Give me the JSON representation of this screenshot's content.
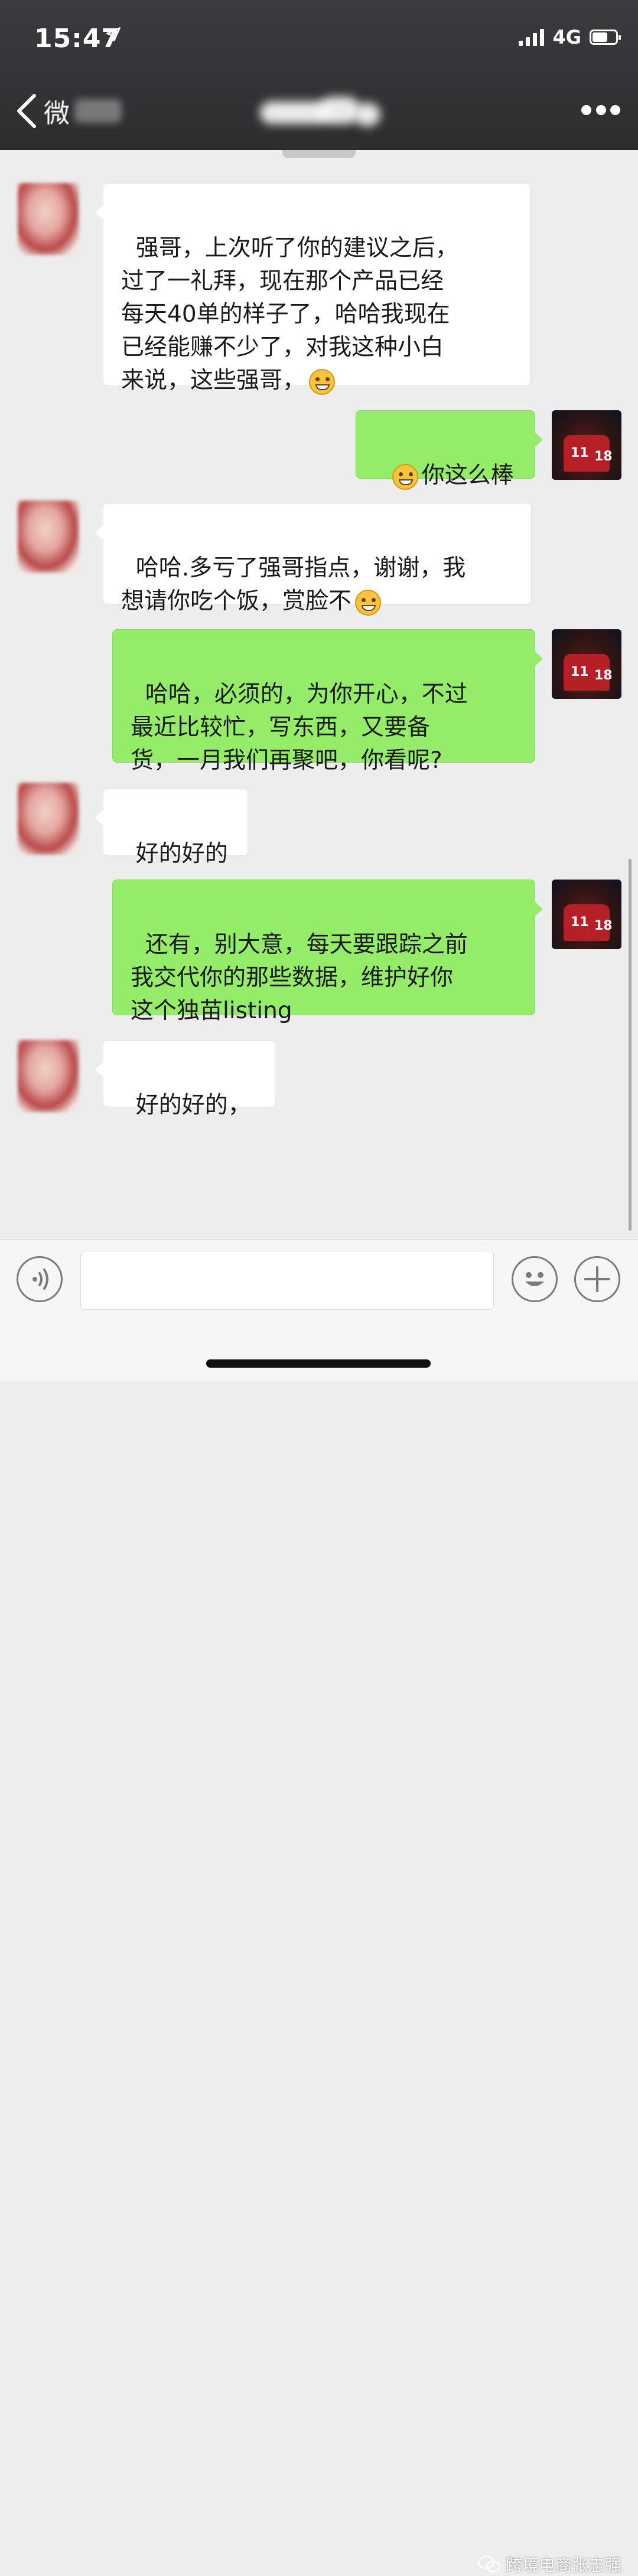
{
  "status_bar": {
    "time": "15:47",
    "network": "4G",
    "battery_level": 0.6
  },
  "nav": {
    "back_label": "微",
    "title": ""
  },
  "messages": [
    {
      "sender": "contact",
      "text": "强哥，上次听了你的建议之后，\n过了一礼拜，现在那个产品已经\n每天40单的样子了，哈哈我现在\n已经能赚不少了，对我这种小白\n来说，这些强哥，",
      "emoji": "shy-smile"
    },
    {
      "sender": "me",
      "text": "你这么棒",
      "emoji_before": "grin"
    },
    {
      "sender": "contact",
      "text": "哈哈.多亏了强哥指点，谢谢，我\n想请你吃个饭，赏脸不",
      "emoji": "grin"
    },
    {
      "sender": "me",
      "text": "哈哈，必须的，为你开心，不过\n最近比较忙，写东西，又要备\n货，一月我们再聚吧，你看呢?"
    },
    {
      "sender": "contact",
      "text": "好的好的"
    },
    {
      "sender": "me",
      "text": "还有，别大意，每天要跟踪之前\n我交代你的那些数据，维护好你\n这个独苗listing"
    },
    {
      "sender": "contact",
      "text": "好的好的，"
    }
  ],
  "my_avatar": {
    "numbers": [
      "11",
      "18"
    ]
  },
  "input": {
    "value": ""
  },
  "watermark": {
    "text": "跨境电商张志强"
  },
  "colors": {
    "nav_bg": "#2f3033",
    "incoming": "#ffffff",
    "outgoing": "#95ec69",
    "chat_bg": "#ededed"
  }
}
